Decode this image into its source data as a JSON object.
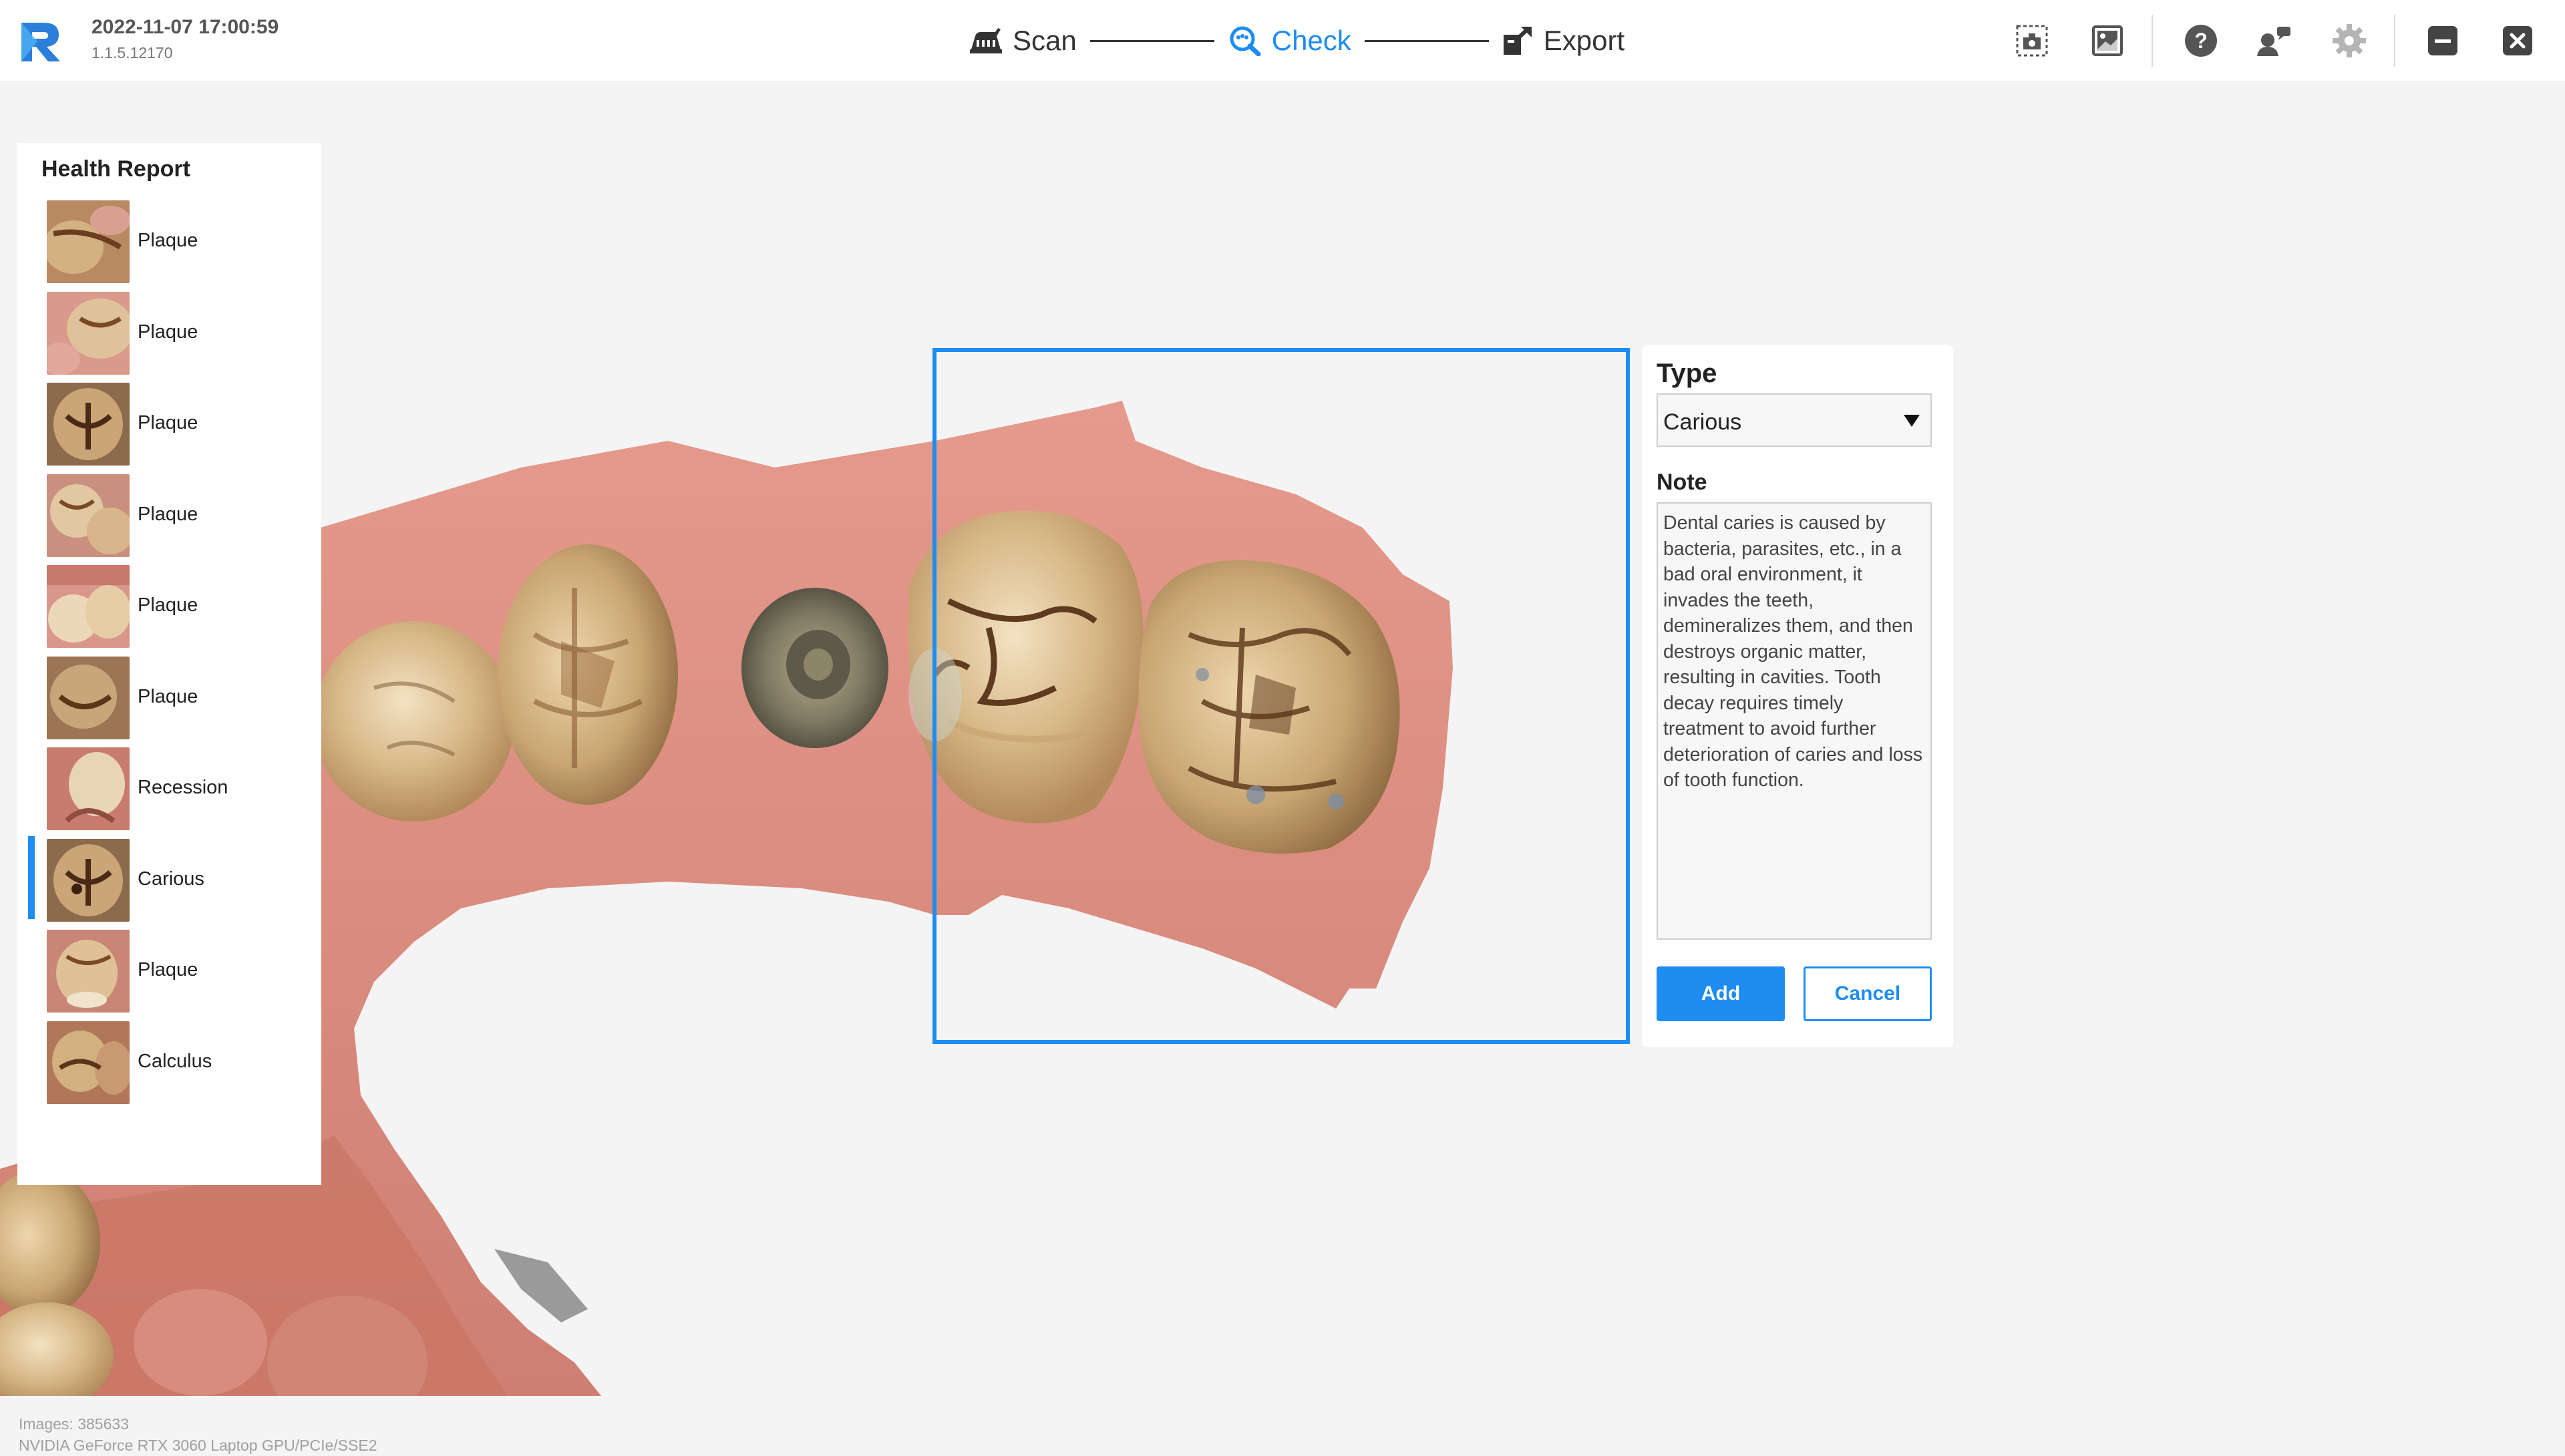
{
  "header": {
    "datetime": "2022-11-07 17:00:59",
    "version": "1.1.5.12170",
    "steps": [
      {
        "label": "Scan",
        "icon": "scanner-icon",
        "active": false
      },
      {
        "label": "Check",
        "icon": "magnifier-icon",
        "active": true
      },
      {
        "label": "Export",
        "icon": "export-icon",
        "active": false
      }
    ],
    "tools": [
      "screenshot-icon",
      "image-gallery-icon",
      "help-icon",
      "user-switch-icon",
      "settings-icon",
      "minimize-icon",
      "close-icon"
    ]
  },
  "health_report": {
    "title": "Health Report",
    "items": [
      {
        "label": "Plaque",
        "selected": false
      },
      {
        "label": "Plaque",
        "selected": false
      },
      {
        "label": "Plaque",
        "selected": false
      },
      {
        "label": "Plaque",
        "selected": false
      },
      {
        "label": "Plaque",
        "selected": false
      },
      {
        "label": "Plaque",
        "selected": false
      },
      {
        "label": "Recession",
        "selected": false
      },
      {
        "label": "Carious",
        "selected": true
      },
      {
        "label": "Plaque",
        "selected": false
      },
      {
        "label": "Calculus",
        "selected": false
      }
    ]
  },
  "annotation": {
    "type_title": "Type",
    "type_value": "Carious",
    "note_title": "Note",
    "note_text": "Dental caries is caused by bacteria, parasites, etc., in a bad oral environment, it invades the teeth, demineralizes them, and then destroys organic matter, resulting in cavities. Tooth decay requires timely treatment to avoid further deterioration of caries and loss of tooth function.",
    "add_label": "Add",
    "cancel_label": "Cancel"
  },
  "render_info": {
    "images": "Images: 385633",
    "gpu": "NVIDIA GeForce RTX 3060 Laptop GPU/PCIe/SSE2"
  },
  "colors": {
    "accent": "#1e8cf0",
    "gum": "#d98a7e",
    "tooth": "#e8d2b0"
  }
}
